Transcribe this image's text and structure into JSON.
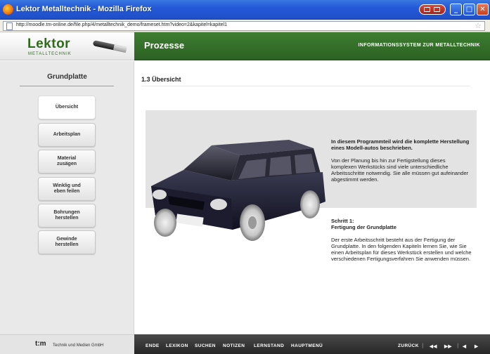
{
  "window": {
    "title": "Lektor Metalltechnik - Mozilla Firefox",
    "url": "http://moodle.tm-online.de/file.php/4/metalltechnik_demo/frameset.htm?video=2&kapitel=kapitel1"
  },
  "header": {
    "logo": "Lektor",
    "logo_sub": "METALLTECHNIK",
    "section_title": "Prozesse",
    "system_title": "INFORMATIONSSYSTEM ZUR METALLTECHNIK"
  },
  "sidebar": {
    "chapter_title": "Grundplatte",
    "items": [
      {
        "label": "Übersicht"
      },
      {
        "label": "Arbeitsplan"
      },
      {
        "label": "Material\nzusägen"
      },
      {
        "label": "Winklig und\neben feilen"
      },
      {
        "label": "Bohrungen\nherstellen"
      },
      {
        "label": "Gewinde\nherstellen"
      }
    ]
  },
  "main": {
    "heading": "1.3 Übersicht",
    "intro_bold": "In diesem Programmteil wird die komplette Herstellung eines Modell-autos beschrieben.",
    "intro_body": "Von der Planung bis hin zur Fertigstellung dieses komplexen Werkstücks sind viele unterschiedliche Arbeitsschritte notwendig. Sie alle müssen gut aufeinander abgestimmt werden.",
    "step_title": "Schritt 1:",
    "step_subtitle": "Fertigung der Grundplatte",
    "step_body": "Der erste Arbeitsschritt besteht aus der Fertigung der Grundplatte. In den folgenden Kapiteln lernen Sie, wie Sie einen Arbeitsplan für dieses Werkstück erstellen und welche verschiedenen Fertigungsverfahren Sie anwenden müssen."
  },
  "footer": {
    "brand": "t:m",
    "company": "Technik und Medien GmbH",
    "links": [
      "ENDE",
      "LEXIKON",
      "SUCHEN",
      "NOTIZEN",
      "LERNSTAND",
      "HAUPTMENÜ"
    ],
    "back_label": "ZURÜCK",
    "first_icon": "◀◀",
    "last_icon": "▶▶",
    "prev_icon": "◀",
    "next_icon": "▶"
  },
  "colors": {
    "brand_green": "#3e7e31",
    "footer_dark": "#333333"
  }
}
